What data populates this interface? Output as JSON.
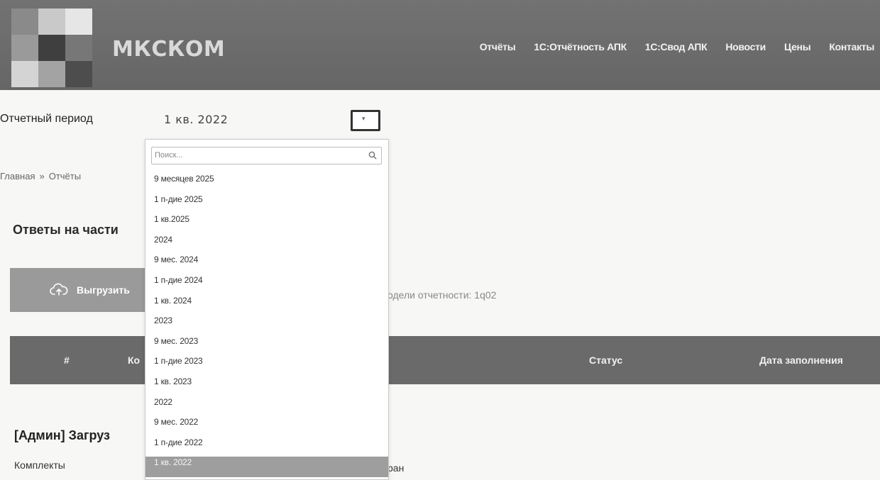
{
  "brand": {
    "name": "МКСКОМ"
  },
  "nav": [
    "Отчёты",
    "1С:Отчётность АПК",
    "1С:Свод АПК",
    "Новости",
    "Цены",
    "Контакты"
  ],
  "period": {
    "label": "Отчетный период",
    "value": "1 кв. 2022",
    "toggle_icon": "chevron-down-icon"
  },
  "dropdown": {
    "search_placeholder": "Поиск...",
    "options": [
      "9 месяцев 2025",
      "1 п-дие 2025",
      "1 кв.2025",
      "2024",
      "9 мес. 2024",
      "1 п-дие 2024",
      "1 кв. 2024",
      "2023",
      "9 мес. 2023",
      "1 п-дие 2023",
      "1 кв. 2023",
      "2022",
      "9 мес. 2022",
      "1 п-дие 2022",
      "1 кв. 2022"
    ],
    "selected_index": 14
  },
  "breadcrumb": {
    "home": "Главная",
    "separator": "»",
    "current": "Отчёты"
  },
  "section": {
    "title": "Ответы на части",
    "upload_label": "Выгрузить",
    "upload_icon": "cloud-upload-icon",
    "model_text": "одели отчетности: 1q02"
  },
  "table": {
    "headers": {
      "num": "#",
      "name": "Ко",
      "status": "Статус",
      "date": "Дата заполнения"
    }
  },
  "admin": {
    "title": "[Админ] Загруз",
    "sets_label": "Комплекты",
    "row_fragment": "ран"
  },
  "colors": {
    "header_bg": "#6b6b6b",
    "selected_bg": "#9e9e9e",
    "button_bg": "#9a9a9a"
  }
}
